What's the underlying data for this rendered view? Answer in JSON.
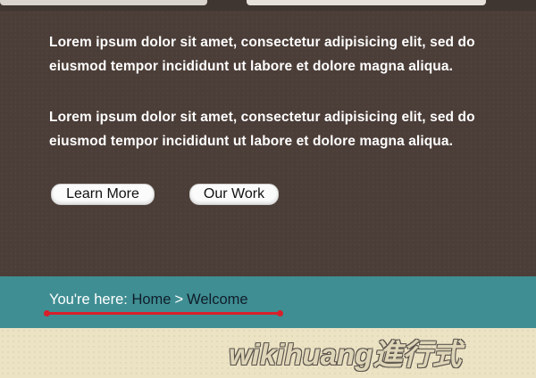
{
  "content": {
    "paragraphs": [
      "Lorem ipsum dolor sit amet, consectetur adipisicing elit, sed do eiusmod tempor incididunt ut labore et dolore magna aliqua.",
      "Lorem ipsum dolor sit amet, consectetur adipisicing elit, sed do eiusmod tempor incididunt ut labore et dolore magna aliqua."
    ],
    "buttons": {
      "learn_more": "Learn More",
      "our_work": "Our Work"
    }
  },
  "breadcrumb": {
    "prefix": "You're here:",
    "items": [
      "Home",
      "Welcome"
    ],
    "separator": ">"
  },
  "watermark": "wikihuang進行式",
  "colors": {
    "content_bg": "#4b3d37",
    "breadcrumb_bg": "#3f8e93",
    "annotation_red": "#d81f2a",
    "footer_bg": "#ece3c4"
  }
}
